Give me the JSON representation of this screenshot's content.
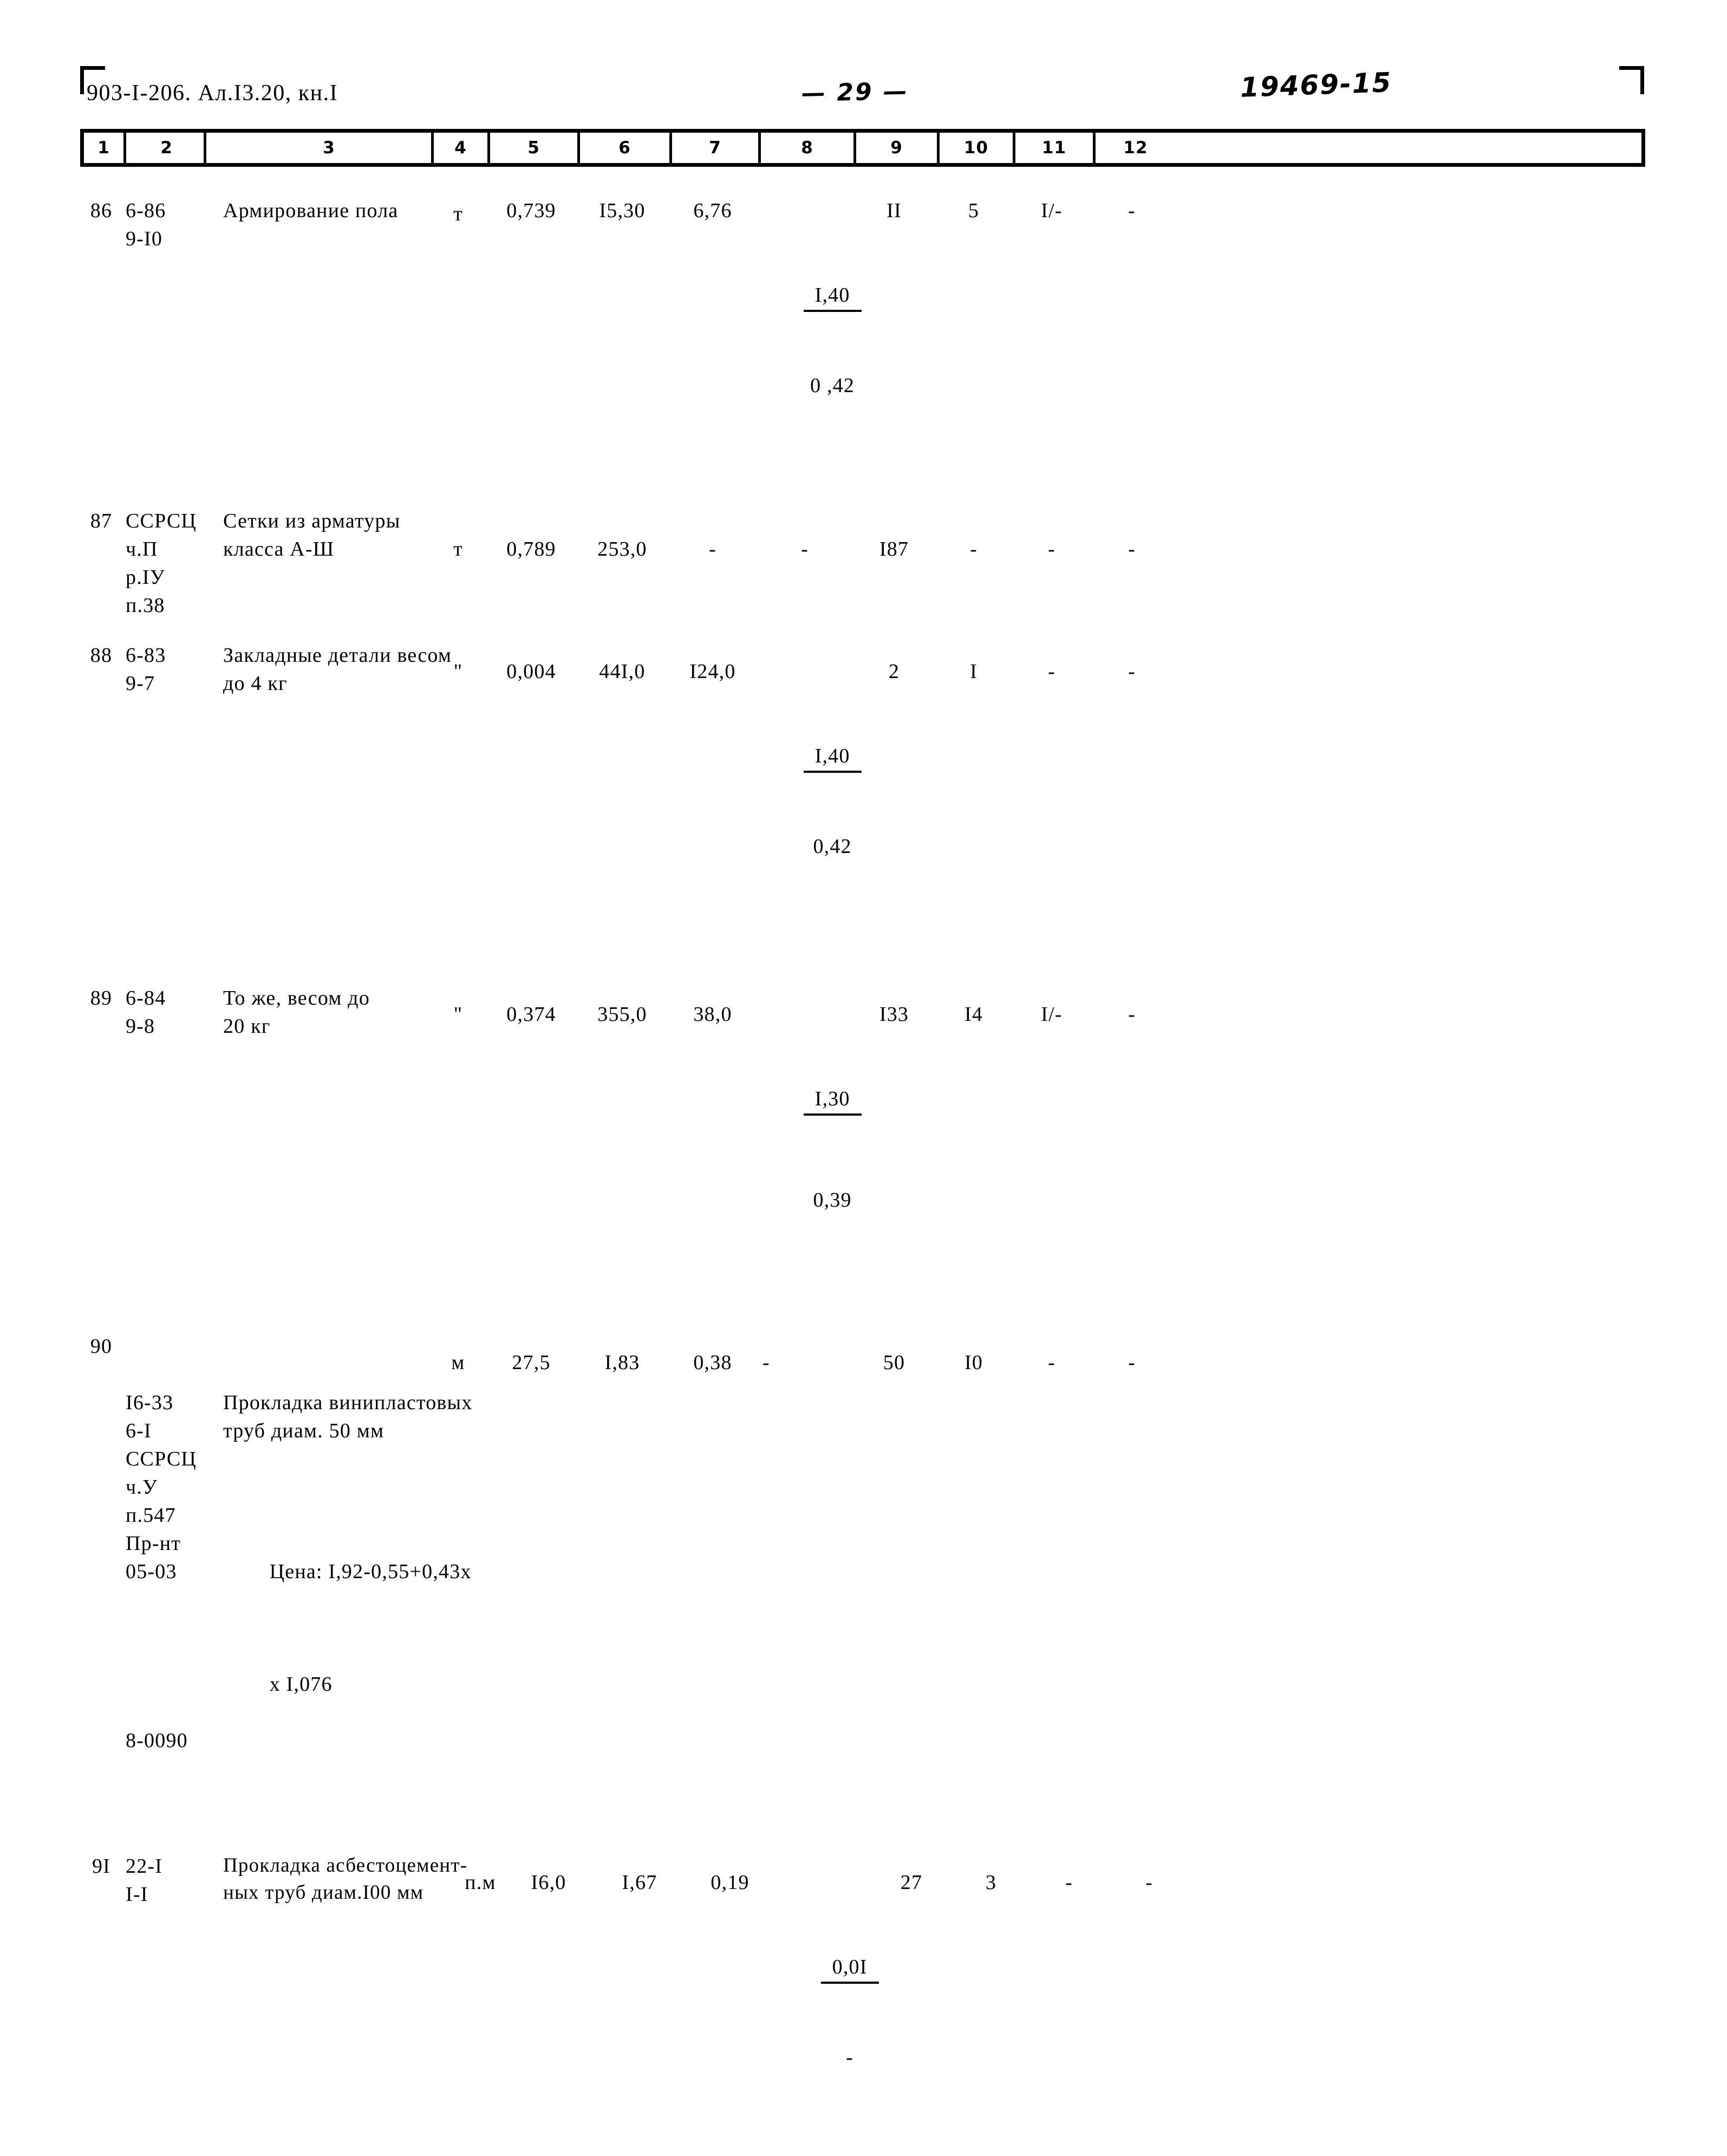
{
  "document": {
    "header_left": "903-I-206. Ал.I3.20, кн.I",
    "page_number": "— 29 —",
    "stamp_number": "19469-15"
  },
  "table": {
    "column_headers": [
      "1",
      "2",
      "3",
      "4",
      "5",
      "6",
      "7",
      "8",
      "9",
      "10",
      "11",
      "12"
    ],
    "rows": [
      {
        "num": "86",
        "code": "6-86\n9-I0",
        "description": "Армирование пола",
        "unit": "т",
        "c5": "0,739",
        "c6": "I5,30",
        "c7": "6,76",
        "c8_num": "I,40",
        "c8_den": "0 ,42",
        "c9": "II",
        "c10": "5",
        "c11": "I/-",
        "c12": "-"
      },
      {
        "num": "87",
        "code": "ССРСЦ\nч.П\nр.IУ\nп.38",
        "description": "Сетки из арматуры\nкласса А-Ш",
        "unit": "т",
        "c5": "0,789",
        "c6": "253,0",
        "c7": "-",
        "c8": "-",
        "c9": "I87",
        "c10": "-",
        "c11": "-",
        "c12": "-"
      },
      {
        "num": "88",
        "code": "6-83\n9-7",
        "description": "Закладные детали весом\nдо 4 кг",
        "unit": "\"",
        "c5": "0,004",
        "c6": "44I,0",
        "c7": "I24,0",
        "c8_num": "I,40",
        "c8_den": "0,42",
        "c9": "2",
        "c10": "I",
        "c11": "-",
        "c12": "-"
      },
      {
        "num": "89",
        "code": "6-84\n9-8",
        "description": "То же, весом до\n20 кг",
        "unit": "\"",
        "c5": "0,374",
        "c6": "355,0",
        "c7": "38,0",
        "c8_num": "I,30",
        "c8_den": "0,39",
        "c9": "I33",
        "c10": "I4",
        "c11": "I/-",
        "c12": "-"
      },
      {
        "num": "90",
        "code": "I6-33\n6-I\nССРСЦ\nч.У\nп.547\nПр-нт\n05-03",
        "code_extra": "8-0090",
        "description": "Прокладка винипластовых\nтруб диам. 50 мм",
        "note1": "Цена: I,92-0,55+0,43х",
        "note2": "х I,076",
        "unit": "м",
        "c5": "27,5",
        "c6": "I,83",
        "c7": "0,38",
        "c8": "-",
        "c9": "50",
        "c10": "I0",
        "c11": "-",
        "c12": "-"
      },
      {
        "num": "9I",
        "code": "22-I\nI-I",
        "description": "Прокладка асбестоцемент-\nных труб диам.I00 мм",
        "unit": "п.м",
        "c5": "I6,0",
        "c6": "I,67",
        "c7": "0,19",
        "c8_num": "0,0I",
        "c8_den": "-",
        "c9": "27",
        "c10": "3",
        "c11": "-",
        "c12": "-"
      }
    ]
  }
}
